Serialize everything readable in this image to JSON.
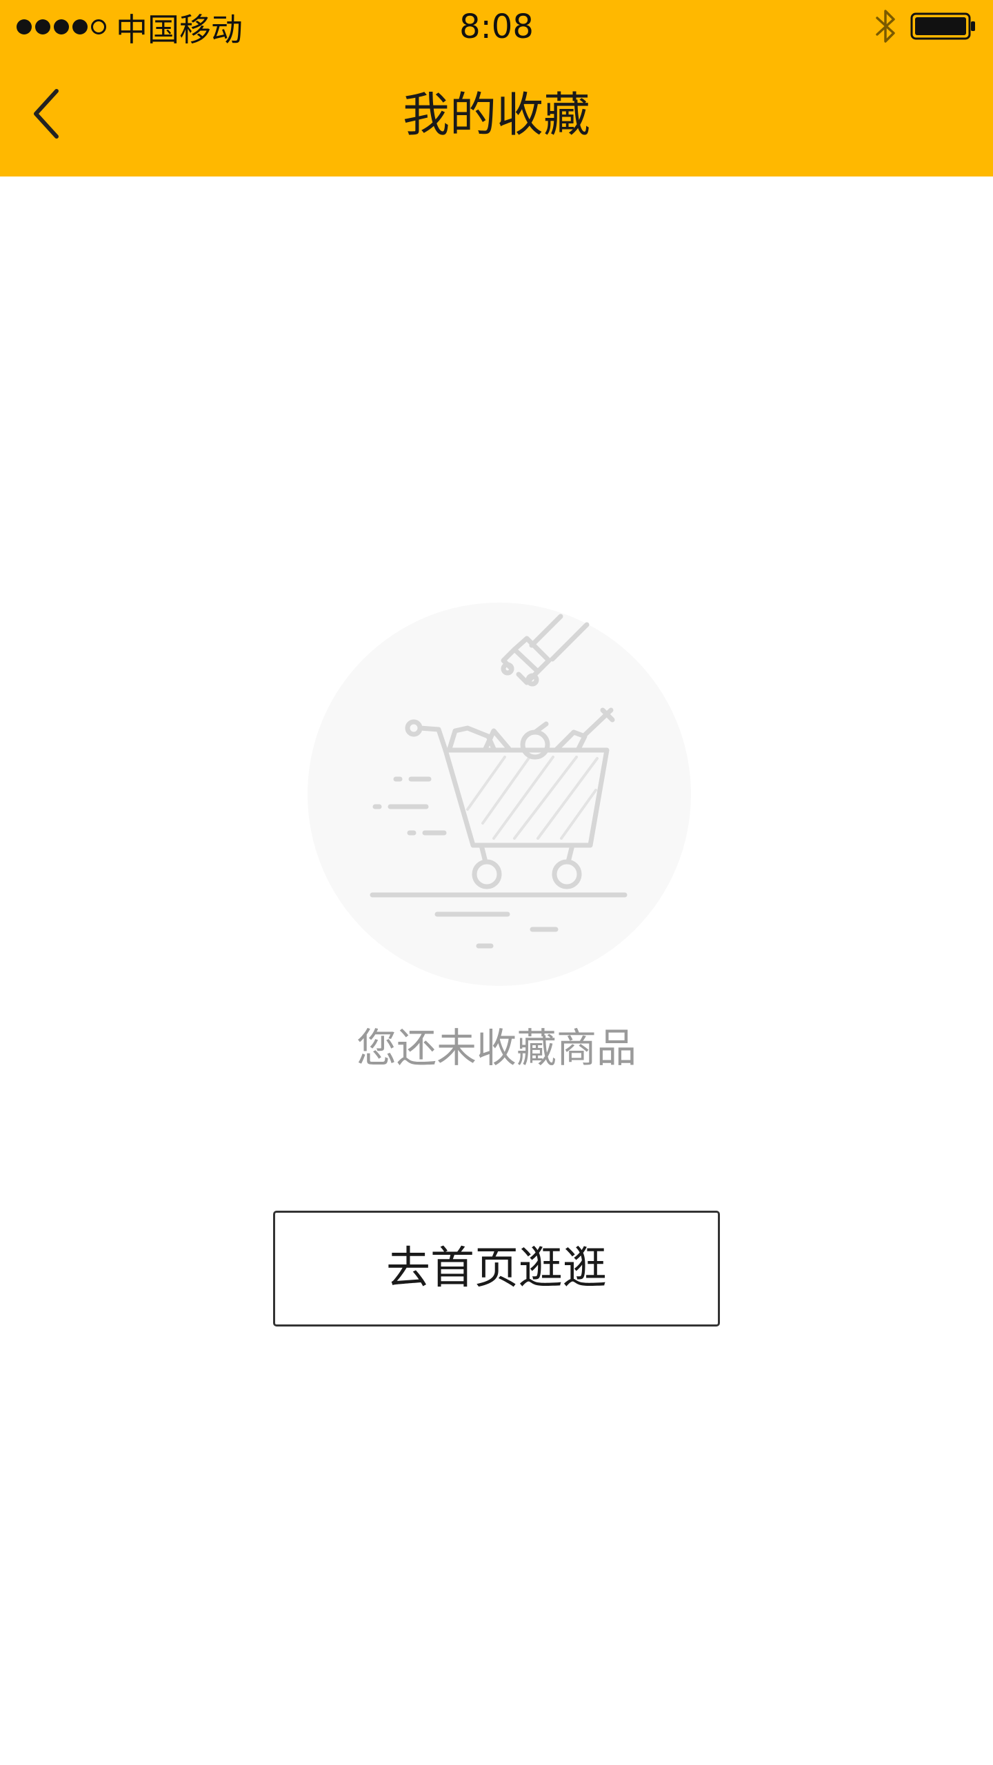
{
  "status_bar": {
    "carrier": "中国移动",
    "time": "8:08",
    "signal_filled": 4,
    "signal_total": 5,
    "bluetooth_icon": "bluetooth-icon",
    "battery_level": 1.0
  },
  "nav": {
    "title": "我的收藏",
    "back_icon": "chevron-left-icon"
  },
  "empty_state": {
    "illustration": "shopping-cart-icon",
    "message": "您还未收藏商品"
  },
  "actions": {
    "go_home_label": "去首页逛逛"
  },
  "colors": {
    "header_background": "#FFB800",
    "message_text": "#9a9a9a",
    "illustration_gray": "#d6d6d6",
    "illustration_circle": "#f8f8f8"
  }
}
